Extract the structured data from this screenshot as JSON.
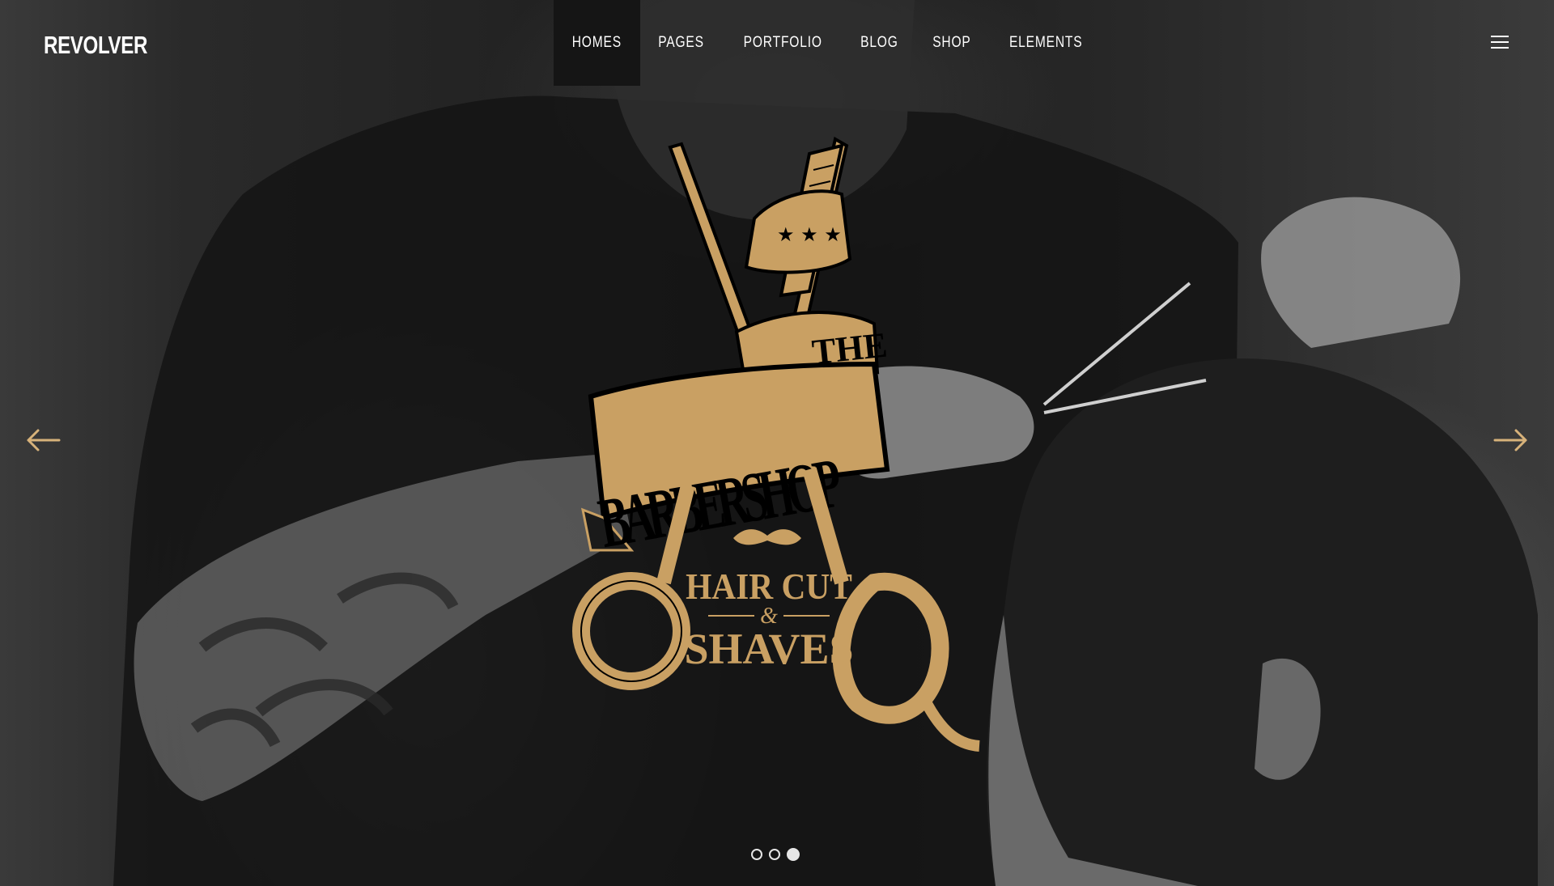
{
  "brand": {
    "name": "REVOLVER"
  },
  "nav": {
    "items": [
      {
        "label": "HOMES",
        "active": true
      },
      {
        "label": "PAGES",
        "active": false
      },
      {
        "label": "PORTFOLIO",
        "active": false
      },
      {
        "label": "BLOG",
        "active": false
      },
      {
        "label": "SHOP",
        "active": false
      },
      {
        "label": "ELEMENTS",
        "active": false
      }
    ]
  },
  "icons": {
    "menu": "hamburger-menu-icon",
    "prev": "arrow-left-icon",
    "next": "arrow-right-icon"
  },
  "hero": {
    "emblem": {
      "top_word": "THE",
      "main_word": "BARBERSHOP",
      "line1": "HAIR CUT",
      "ampersand": "&",
      "line2": "SHAVES"
    }
  },
  "slider": {
    "slides": 3,
    "active_slide": 3
  },
  "colors": {
    "gold": "#c9a063",
    "arrow_gold": "#d7b27a",
    "nav_active_bg": "#151515",
    "text": "#ffffff"
  }
}
